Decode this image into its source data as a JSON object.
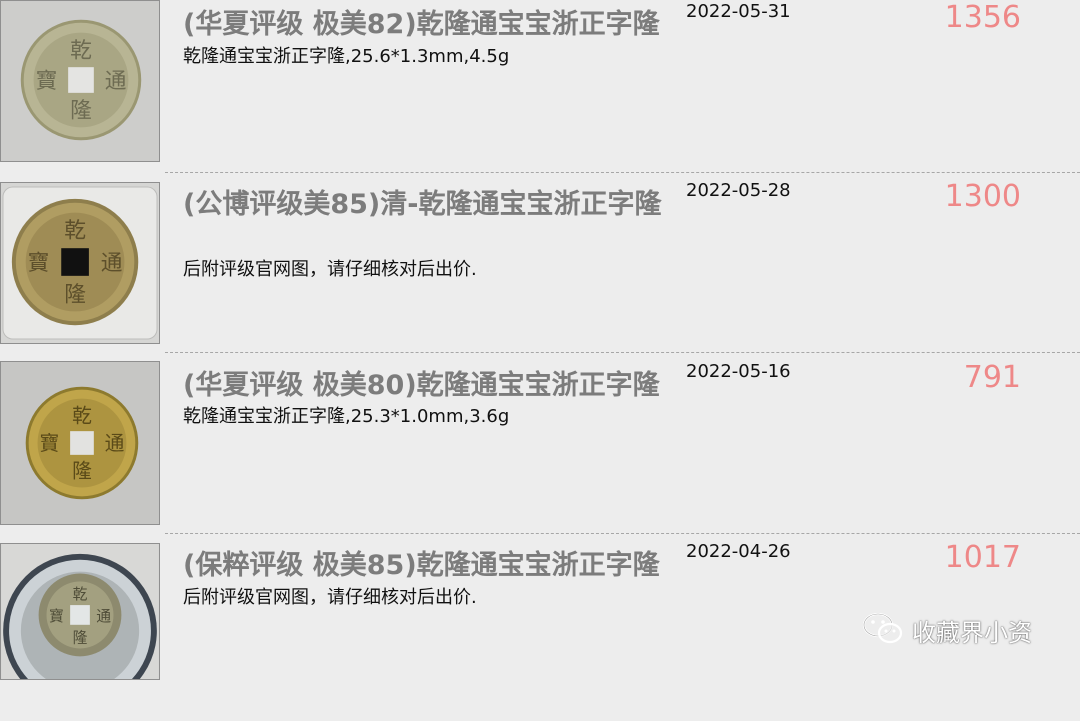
{
  "listings": [
    {
      "title": "(华夏评级 极美82)乾隆通宝宝浙正字隆",
      "description": "乾隆通宝宝浙正字隆,25.6*1.3mm,4.5g",
      "date": "2022-05-31",
      "price": "1356",
      "image_icon": "coin-photo-icon"
    },
    {
      "title": "(公博评级美85)清-乾隆通宝宝浙正字隆",
      "description": "后附评级官网图，请仔细核对后出价.",
      "date": "2022-05-28",
      "price": "1300",
      "image_icon": "coin-photo-icon"
    },
    {
      "title": "(华夏评级 极美80)乾隆通宝宝浙正字隆",
      "description": "乾隆通宝宝浙正字隆,25.3*1.0mm,3.6g",
      "date": "2022-05-16",
      "price": "791",
      "image_icon": "coin-photo-icon"
    },
    {
      "title": "(保粹评级 极美85)乾隆通宝宝浙正字隆",
      "description": "后附评级官网图，请仔细核对后出价.",
      "date": "2022-04-26",
      "price": "1017",
      "image_icon": "coin-photo-icon"
    }
  ],
  "watermark": {
    "text": "收藏界小资",
    "icon": "wechat-icon"
  },
  "colors": {
    "background": "#ededed",
    "title": "#7c7c7c",
    "price": "#ee8888",
    "text": "#111111"
  }
}
